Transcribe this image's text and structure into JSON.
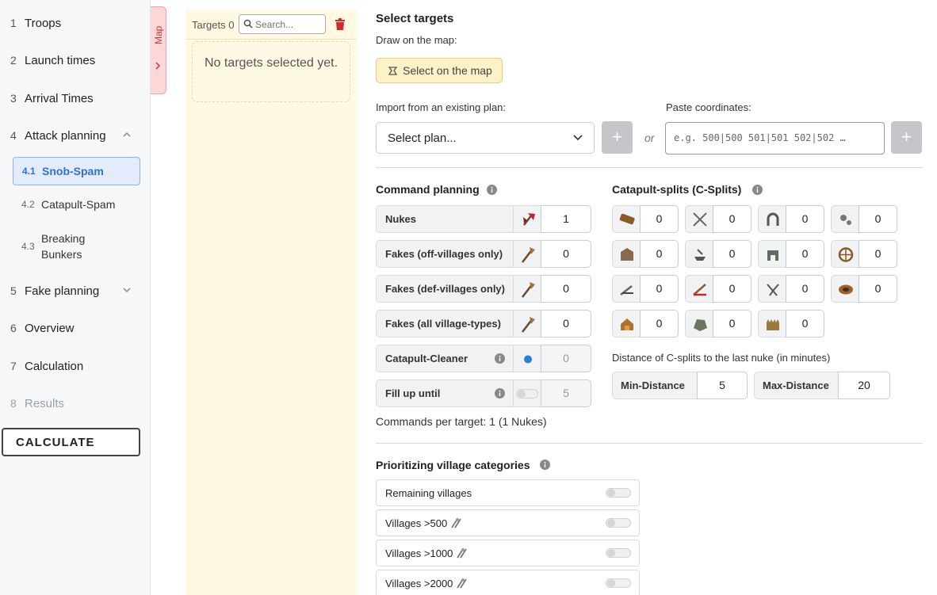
{
  "sidebar": {
    "items": [
      {
        "num": "1",
        "label": "Troops"
      },
      {
        "num": "2",
        "label": "Launch times"
      },
      {
        "num": "3",
        "label": "Arrival Times"
      },
      {
        "num": "4",
        "label": "Attack planning"
      },
      {
        "num": "5",
        "label": "Fake planning"
      },
      {
        "num": "6",
        "label": "Overview"
      },
      {
        "num": "7",
        "label": "Calculation"
      },
      {
        "num": "8",
        "label": "Results"
      }
    ],
    "sub_items": [
      {
        "num": "4.1",
        "label": "Snob-Spam"
      },
      {
        "num": "4.2",
        "label": "Catapult-Spam"
      },
      {
        "num": "4.3",
        "label": "Breaking Bunkers"
      }
    ],
    "calculate_label": "CALCULATE"
  },
  "map_tab": {
    "label": "Map"
  },
  "targets": {
    "label": "Targets 0",
    "search_placeholder": "Search...",
    "empty_text": "No targets selected yet."
  },
  "select_targets": {
    "title": "Select targets",
    "draw_label": "Draw on the map:",
    "map_button": "Select on the map",
    "import_label": "Import from an existing plan:",
    "select_placeholder": "Select plan...",
    "or": "or",
    "paste_label": "Paste coordinates:",
    "coords_placeholder": "e.g. 500|500 501|501 502|502 …",
    "plus": "+"
  },
  "command_planning": {
    "title": "Command planning",
    "rows": [
      {
        "label": "Nukes",
        "value": "1"
      },
      {
        "label": "Fakes (off-villages only)",
        "value": "0"
      },
      {
        "label": "Fakes (def-villages only)",
        "value": "0"
      },
      {
        "label": "Fakes (all village-types)",
        "value": "0"
      },
      {
        "label": "Catapult-Cleaner",
        "value": "0"
      },
      {
        "label": "Fill up until",
        "value": "5"
      }
    ],
    "summary": "Commands per target: 1 (1 Nukes)"
  },
  "csplits": {
    "title": "Catapult-splits (C-Splits)",
    "values": [
      "0",
      "0",
      "0",
      "0",
      "0",
      "0",
      "0",
      "0",
      "0",
      "0",
      "0",
      "0",
      "0",
      "0",
      "0"
    ],
    "icons": [
      "wood-icon",
      "crossed-swords-icon",
      "horseshoe-icon",
      "gears-icon",
      "castle-icon",
      "smith-icon",
      "gate-icon",
      "wheel-icon",
      "crossbow-icon",
      "catapult-icon",
      "trebuchet-icon",
      "clay-icon",
      "market-icon",
      "ore-icon",
      "wall-icon"
    ],
    "distance_label": "Distance of C-splits to the last nuke (in minutes)",
    "min_label": "Min-Distance",
    "min_value": "5",
    "max_label": "Max-Distance",
    "max_value": "20"
  },
  "prioritizing": {
    "title": "Prioritizing village categories",
    "rows": [
      "Remaining villages",
      "Villages >500",
      "Villages >1000",
      "Villages >2000"
    ]
  },
  "colors": {
    "accent": "#2f6fdb",
    "targets_bg": "#fff8e2",
    "map_tab": "#fbd7d7"
  }
}
